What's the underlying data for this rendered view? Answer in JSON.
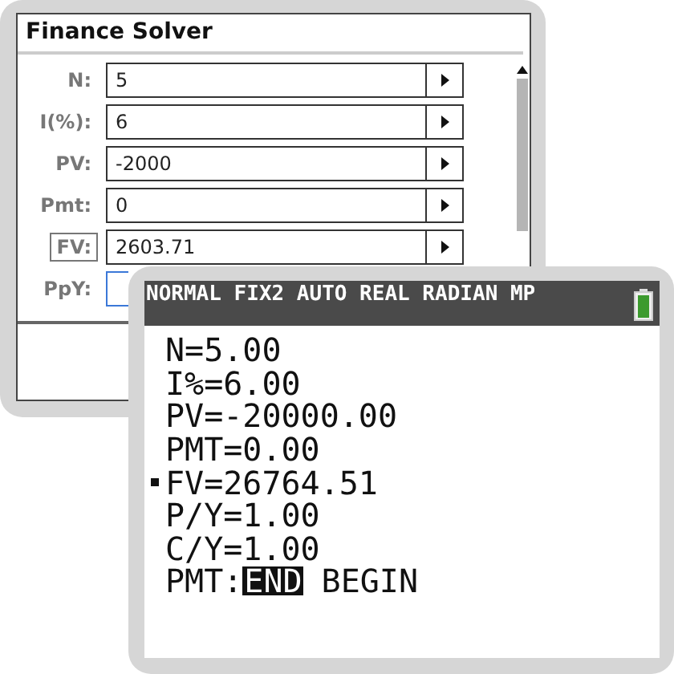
{
  "solver_window": {
    "title": "Finance Solver",
    "fields": [
      {
        "label": "N:",
        "value": "5",
        "boxed": false,
        "focused": false
      },
      {
        "label": "I(%):",
        "value": "6",
        "boxed": false,
        "focused": false
      },
      {
        "label": "PV:",
        "value": "-2000",
        "boxed": false,
        "focused": false
      },
      {
        "label": "Pmt:",
        "value": "0",
        "boxed": false,
        "focused": false
      },
      {
        "label": "FV:",
        "value": "2603.71",
        "boxed": true,
        "focused": false
      },
      {
        "label": "PpY:",
        "boxed": false,
        "focused": true
      }
    ]
  },
  "calculator": {
    "status_bar": "NORMAL FIX2 AUTO REAL RADIAN MP",
    "lines": [
      {
        "kind": "value",
        "text": "N=5.00",
        "selected": false
      },
      {
        "kind": "value",
        "text": "I%=6.00",
        "selected": false
      },
      {
        "kind": "value",
        "text": "PV=-20000.00",
        "selected": false
      },
      {
        "kind": "value",
        "text": "PMT=0.00",
        "selected": false
      },
      {
        "kind": "value",
        "text": "FV=26764.51",
        "selected": true
      },
      {
        "kind": "value",
        "text": "P/Y=1.00",
        "selected": false
      },
      {
        "kind": "value",
        "text": "C/Y=1.00",
        "selected": false
      },
      {
        "kind": "toggle",
        "text": "PMT:",
        "selected": false,
        "options": [
          {
            "label": "END",
            "selected": true
          },
          {
            "label": "BEGIN",
            "selected": false
          }
        ]
      }
    ]
  }
}
